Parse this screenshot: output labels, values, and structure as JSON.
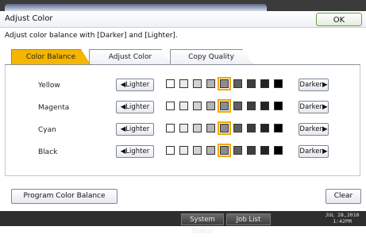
{
  "header": {
    "title": "Adjust Color",
    "ok_label": "OK"
  },
  "instruction": "Adjust color balance with [Darker] and [Lighter].",
  "tabs": [
    {
      "label": "Color Balance",
      "active": true
    },
    {
      "label": "Adjust Color",
      "active": false
    },
    {
      "label": "Copy Quality",
      "active": false
    }
  ],
  "rows": [
    {
      "label": "Yellow",
      "lighter_label": "Lighter",
      "darker_label": "Darker",
      "level_index": 4,
      "levels": 9
    },
    {
      "label": "Magenta",
      "lighter_label": "Lighter",
      "darker_label": "Darker",
      "level_index": 4,
      "levels": 9
    },
    {
      "label": "Cyan",
      "lighter_label": "Lighter",
      "darker_label": "Darker",
      "level_index": 4,
      "levels": 9
    },
    {
      "label": "Black",
      "lighter_label": "Lighter",
      "darker_label": "Darker",
      "level_index": 4,
      "levels": 9
    }
  ],
  "swatch_colors": [
    "#ffffff",
    "#ebebeb",
    "#d2d2d2",
    "#b4b4b4",
    "#8c8c8c",
    "#5e5e5e",
    "#3e3e3e",
    "#242424",
    "#000000"
  ],
  "footer": {
    "program_label": "Program Color Balance",
    "clear_label": "Clear"
  },
  "statusbar": {
    "system_status": "System Status",
    "job_list": "Job List",
    "date": "JUL  28,2010",
    "time": "1:42PM"
  },
  "colors": {
    "active_tab": "#f5b600",
    "selection": "#f0a800",
    "ok_border": "#6d9c4a"
  }
}
